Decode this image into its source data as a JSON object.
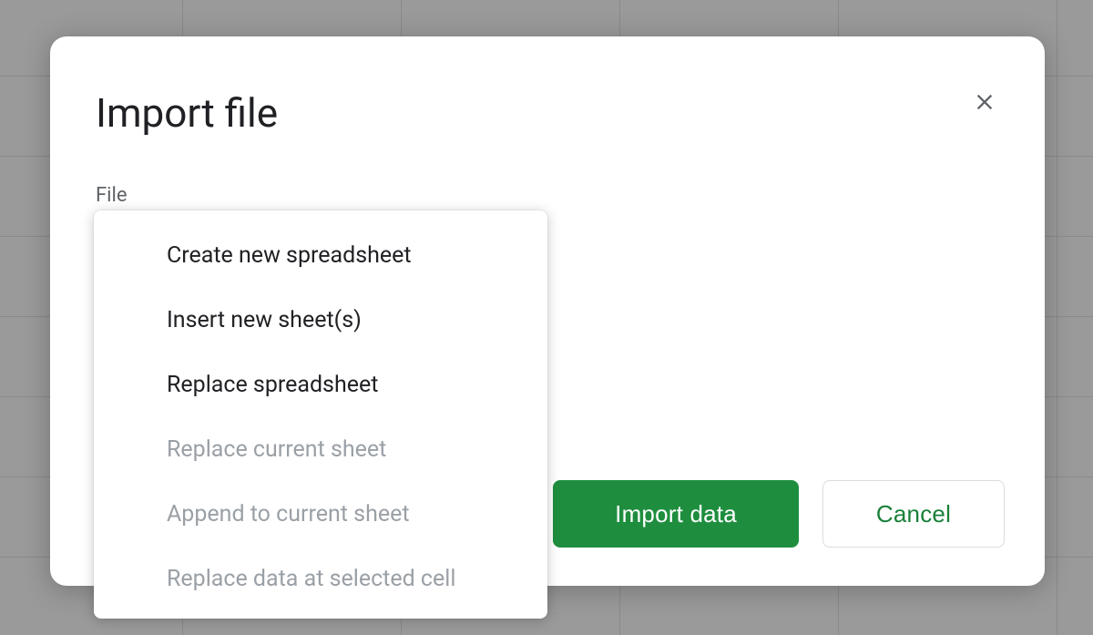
{
  "dialog": {
    "title": "Import file",
    "file_label": "File"
  },
  "menu": {
    "options": [
      {
        "label": "Create new spreadsheet",
        "enabled": true
      },
      {
        "label": "Insert new sheet(s)",
        "enabled": true
      },
      {
        "label": "Replace spreadsheet",
        "enabled": true
      },
      {
        "label": "Replace current sheet",
        "enabled": false
      },
      {
        "label": "Append to current sheet",
        "enabled": false
      },
      {
        "label": "Replace data at selected cell",
        "enabled": false
      }
    ]
  },
  "buttons": {
    "primary": "Import data",
    "secondary": "Cancel"
  },
  "colors": {
    "primary_button_bg": "#1e8e3e",
    "secondary_button_text": "#188038",
    "title_text": "#202124",
    "muted_text": "#5f6368",
    "disabled_text": "#9aa0a6"
  }
}
